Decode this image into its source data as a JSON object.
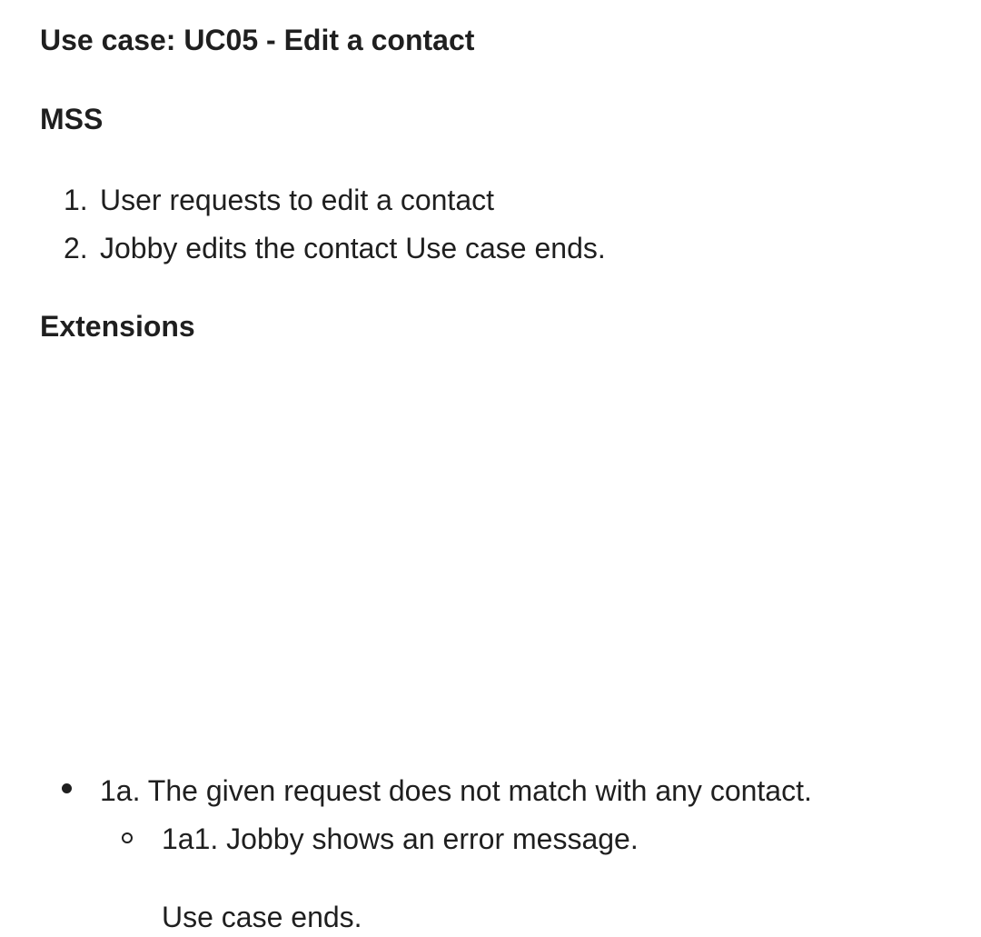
{
  "title": "Use case: UC05 - Edit a contact",
  "mss": {
    "heading": "MSS",
    "steps": [
      {
        "number": "1.",
        "text": "User requests to edit a contact"
      },
      {
        "number": "2.",
        "text": "Jobby edits the contact Use case ends."
      }
    ]
  },
  "extensions": {
    "heading": "Extensions",
    "items": [
      {
        "text": "1a. The given request does not match with any contact.",
        "sub_items": [
          {
            "text": "1a1. Jobby shows an error message.",
            "end_text": "Use case ends."
          }
        ]
      }
    ]
  }
}
